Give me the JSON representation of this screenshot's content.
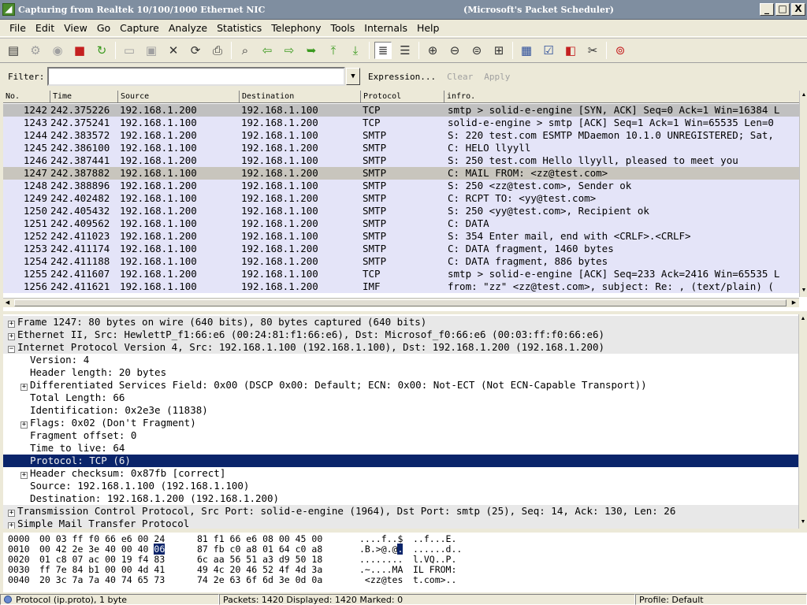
{
  "window": {
    "title": "Capturing from Realtek 10/100/1000 Ethernet NIC",
    "subtitle": "(Microsoft's Packet Scheduler)",
    "min_label": "_",
    "max_label": "□",
    "close_label": "X"
  },
  "menu": [
    "File",
    "Edit",
    "View",
    "Go",
    "Capture",
    "Analyze",
    "Statistics",
    "Telephony",
    "Tools",
    "Internals",
    "Help"
  ],
  "filter": {
    "label": "Filter:",
    "value": "",
    "expression": "Expression...",
    "clear": "Clear",
    "apply": "Apply"
  },
  "packet_list": {
    "columns": [
      "No.",
      "Time",
      "Source",
      "Destination",
      "Protocol",
      "infro."
    ],
    "rows": [
      {
        "no": "1242",
        "time": "242.375226",
        "src": "192.168.1.200",
        "dst": "192.168.1.100",
        "proto": "TCP",
        "info": "smtp > solid-e-engine [SYN, ACK] Seq=0 Ack=1 Win=16384 L"
      },
      {
        "no": "1243",
        "time": "242.375241",
        "src": "192.168.1.100",
        "dst": "192.168.1.200",
        "proto": "TCP",
        "info": "solid-e-engine > smtp [ACK] Seq=1 Ack=1 Win=65535 Len=0"
      },
      {
        "no": "1244",
        "time": "242.383572",
        "src": "192.168.1.200",
        "dst": "192.168.1.100",
        "proto": "SMTP",
        "info": "S: 220 test.com ESMTP MDaemon 10.1.0 UNREGISTERED; Sat,"
      },
      {
        "no": "1245",
        "time": "242.386100",
        "src": "192.168.1.100",
        "dst": "192.168.1.200",
        "proto": "SMTP",
        "info": "C: HELO llyyll"
      },
      {
        "no": "1246",
        "time": "242.387441",
        "src": "192.168.1.200",
        "dst": "192.168.1.100",
        "proto": "SMTP",
        "info": "S: 250 test.com Hello llyyll, pleased to meet you"
      },
      {
        "no": "1247",
        "time": "242.387882",
        "src": "192.168.1.100",
        "dst": "192.168.1.200",
        "proto": "SMTP",
        "info": "C: MAIL FROM: <zz@test.com>"
      },
      {
        "no": "1248",
        "time": "242.388896",
        "src": "192.168.1.200",
        "dst": "192.168.1.100",
        "proto": "SMTP",
        "info": "S: 250 <zz@test.com>, Sender ok"
      },
      {
        "no": "1249",
        "time": "242.402482",
        "src": "192.168.1.100",
        "dst": "192.168.1.200",
        "proto": "SMTP",
        "info": "C: RCPT TO: <yy@test.com>"
      },
      {
        "no": "1250",
        "time": "242.405432",
        "src": "192.168.1.200",
        "dst": "192.168.1.100",
        "proto": "SMTP",
        "info": "S: 250 <yy@test.com>, Recipient ok"
      },
      {
        "no": "1251",
        "time": "242.409562",
        "src": "192.168.1.100",
        "dst": "192.168.1.200",
        "proto": "SMTP",
        "info": "C: DATA"
      },
      {
        "no": "1252",
        "time": "242.411023",
        "src": "192.168.1.200",
        "dst": "192.168.1.100",
        "proto": "SMTP",
        "info": "S: 354 Enter mail, end with <CRLF>.<CRLF>"
      },
      {
        "no": "1253",
        "time": "242.411174",
        "src": "192.168.1.100",
        "dst": "192.168.1.200",
        "proto": "SMTP",
        "info": "C: DATA fragment, 1460 bytes"
      },
      {
        "no": "1254",
        "time": "242.411188",
        "src": "192.168.1.100",
        "dst": "192.168.1.200",
        "proto": "SMTP",
        "info": "C: DATA fragment, 886 bytes"
      },
      {
        "no": "1255",
        "time": "242.411607",
        "src": "192.168.1.200",
        "dst": "192.168.1.100",
        "proto": "TCP",
        "info": "smtp > solid-e-engine [ACK] Seq=233 Ack=2416 Win=65535 L"
      },
      {
        "no": "1256",
        "time": "242.411621",
        "src": "192.168.1.100",
        "dst": "192.168.1.200",
        "proto": "IMF",
        "info": "from: \"zz\" <zz@test.com>, subject: Re: ,  (text/plain) ("
      }
    ],
    "selected_no": "1247"
  },
  "detail": {
    "rows": [
      {
        "level": 0,
        "exp": "+",
        "text": "Frame 1247: 80 bytes on wire (640 bits), 80 bytes captured (640 bits)"
      },
      {
        "level": 0,
        "exp": "+",
        "text": "Ethernet II, Src: HewlettP_f1:66:e6 (00:24:81:f1:66:e6), Dst: Microsof_f0:66:e6 (00:03:ff:f0:66:e6)"
      },
      {
        "level": 0,
        "exp": "-",
        "text": "Internet Protocol Version 4, Src: 192.168.1.100 (192.168.1.100), Dst: 192.168.1.200 (192.168.1.200)"
      },
      {
        "level": 1,
        "exp": "",
        "text": "Version: 4"
      },
      {
        "level": 1,
        "exp": "",
        "text": "Header length: 20 bytes"
      },
      {
        "level": 1,
        "exp": "+",
        "text": "Differentiated Services Field: 0x00 (DSCP 0x00: Default; ECN: 0x00: Not-ECT (Not ECN-Capable Transport))"
      },
      {
        "level": 1,
        "exp": "",
        "text": "Total Length: 66"
      },
      {
        "level": 1,
        "exp": "",
        "text": "Identification: 0x2e3e (11838)"
      },
      {
        "level": 1,
        "exp": "+",
        "text": "Flags: 0x02 (Don't Fragment)"
      },
      {
        "level": 1,
        "exp": "",
        "text": "Fragment offset: 0"
      },
      {
        "level": 1,
        "exp": "",
        "text": "Time to live: 64"
      },
      {
        "level": 1,
        "exp": "",
        "text": "Protocol: TCP (6)",
        "selected": true
      },
      {
        "level": 1,
        "exp": "+",
        "text": "Header checksum: 0x87fb [correct]"
      },
      {
        "level": 1,
        "exp": "",
        "text": "Source: 192.168.1.100 (192.168.1.100)"
      },
      {
        "level": 1,
        "exp": "",
        "text": "Destination: 192.168.1.200 (192.168.1.200)"
      },
      {
        "level": 0,
        "exp": "+",
        "text": "Transmission Control Protocol, Src Port: solid-e-engine (1964), Dst Port: smtp (25), Seq: 14, Ack: 130, Len: 26"
      },
      {
        "level": 0,
        "exp": "+",
        "text": "Simple Mail Transfer Protocol"
      }
    ]
  },
  "hex": {
    "rows": [
      {
        "off": "0000",
        "b1": "00 03 ff f0 66 e6 00 24",
        "b2": "81 f1 66 e6 08 00 45 00",
        "a1": "....f..$",
        "a2": "..f...E."
      },
      {
        "off": "0010",
        "b1": "00 42 2e 3e 40 00 40 ",
        "hl": "06",
        "b2": "87 fb c0 a8 01 64 c0 a8",
        "a1": ".B.>@.@.",
        "a2": "......d..",
        "a1_pre": ".B.>@.@",
        "a1_hl": "."
      },
      {
        "off": "0020",
        "b1": "01 c8 07 ac 00 19 f4 83",
        "b2": "6c aa 56 51 a3 d9 50 18",
        "a1": "........",
        "a2": "l.VQ..P."
      },
      {
        "off": "0030",
        "b1": "ff 7e 84 b1 00 00 4d 41",
        "b2": "49 4c 20 46 52 4f 4d 3a",
        "a1": ".~....MA",
        "a2": "IL FROM:"
      },
      {
        "off": "0040",
        "b1": "20 3c 7a 7a 40 74 65 73",
        "b2": "74 2e 63 6f 6d 3e 0d 0a",
        "a1": " <zz@tes",
        "a2": "t.com>.."
      }
    ]
  },
  "status": {
    "left": "Protocol (ip.proto), 1 byte",
    "middle": "Packets: 1420 Displayed: 1420 Marked: 0",
    "right": "Profile: Default"
  },
  "toolbar_icons": [
    "list-interfaces-icon",
    "capture-options-icon",
    "start-capture-icon",
    "stop-capture-icon",
    "restart-capture-icon",
    "open-file-icon",
    "save-file-icon",
    "close-file-icon",
    "reload-icon",
    "print-icon",
    "find-icon",
    "go-back-icon",
    "go-forward-icon",
    "go-to-packet-icon",
    "go-first-icon",
    "go-last-icon",
    "colorize-icon",
    "autoscroll-icon",
    "zoom-in-icon",
    "zoom-out-icon",
    "normal-size-icon",
    "resize-columns-icon",
    "capture-filters-icon",
    "display-filters-icon",
    "coloring-rules-icon",
    "preferences-icon",
    "help-icon"
  ]
}
